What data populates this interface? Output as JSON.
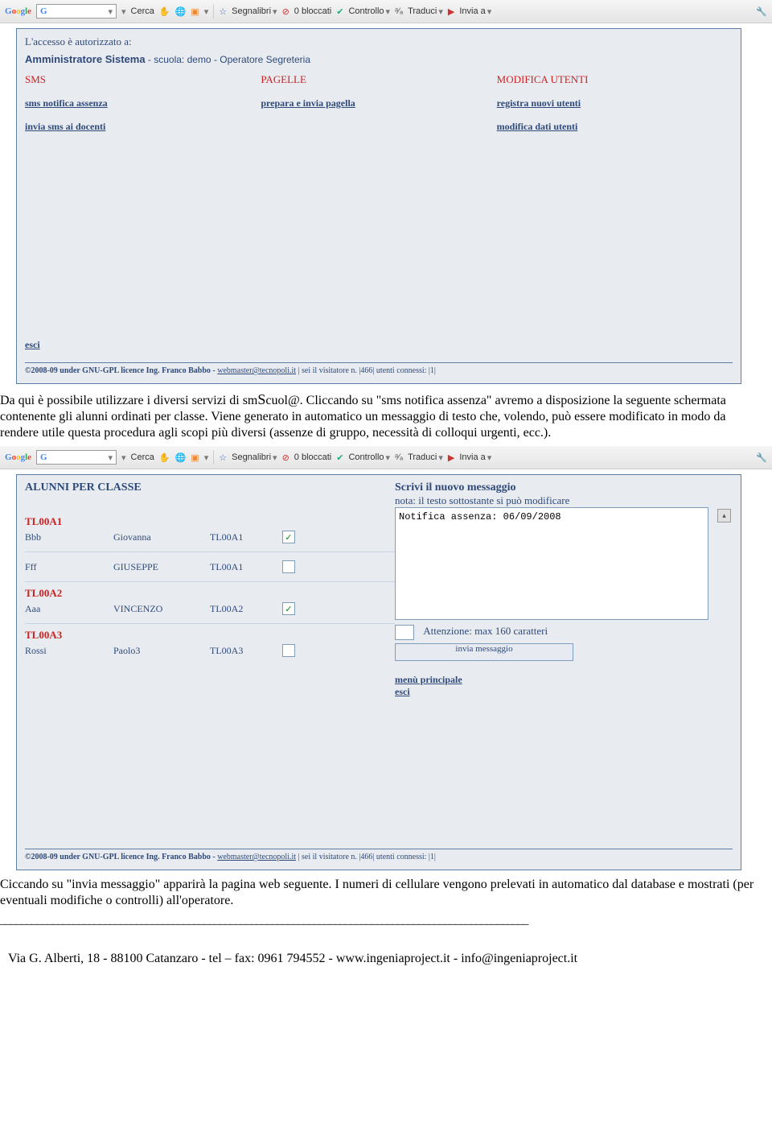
{
  "toolbar": {
    "logo_g": "G",
    "cerca": "Cerca",
    "segnalibri": "Segnalibri",
    "bloccati": "0 bloccati",
    "controllo": "Controllo",
    "traduci": "Traduci",
    "invia": "Invia a"
  },
  "screenshot1": {
    "access_line": "L'accesso è autorizzato a:",
    "admin_title": "Amministratore Sistema",
    "admin_sub": " - scuola: demo - Operatore Segreteria",
    "col1": {
      "head": "SMS",
      "link1": "sms notifica assenza",
      "link2": "invia sms ai docenti"
    },
    "col2": {
      "head": "PAGELLE",
      "link1": "prepara e invia pagella"
    },
    "col3": {
      "head": "MODIFICA UTENTI",
      "link1": "registra nuovi utenti",
      "link2": "modifica dati utenti"
    },
    "esci": "esci",
    "footer": {
      "copy": "©2008-09 under GNU-GPL licence Ing. Franco Babbo - ",
      "webmaster": "webmaster@tecnopoli.it",
      "visit": "  |  sei il visitatore n.  |466|  utenti connessi: |1|"
    }
  },
  "para1": "Da qui è possibile utilizzare i diversi servizi di smScuol@. Cliccando su \"sms notifica assenza\" avremo a disposizione la seguente schermata contenente gli alunni ordinati per classe. Viene generato in automatico un messaggio di testo che, volendo, può essere modificato in modo da rendere utile questa procedura agli scopi più diversi (assenze di gruppo, necessità di colloqui urgenti, ecc.).",
  "screenshot2": {
    "alunni_head": "ALUNNI PER CLASSE",
    "classes": [
      {
        "label": "TL00A1",
        "students": [
          {
            "surname": "Bbb",
            "name": "Giovanna",
            "class": "TL00A1",
            "checked": true
          },
          {
            "surname": "Fff",
            "name": "GIUSEPPE",
            "class": "TL00A1",
            "checked": false
          }
        ]
      },
      {
        "label": "TL00A2",
        "students": [
          {
            "surname": "Aaa",
            "name": "VINCENZO",
            "class": "TL00A2",
            "checked": true
          }
        ]
      },
      {
        "label": "TL00A3",
        "students": [
          {
            "surname": "Rossi",
            "name": "Paolo3",
            "class": "TL00A3",
            "checked": false
          }
        ]
      }
    ],
    "msg_title": "Scrivi il nuovo messaggio",
    "msg_sub": "nota: il testo sottostante si può modificare",
    "msg_text": "Notifica assenza: 06/09/2008",
    "att": "Attenzione: max 160 caratteri",
    "send": "invia messaggio",
    "menu_link": "menù principale",
    "esci": "esci",
    "footer": {
      "copy": "©2008-09 under GNU-GPL licence Ing. Franco Babbo - ",
      "webmaster": "webmaster@tecnopoli.it",
      "visit": "  |  sei il visitatore n.  |466|  utenti connessi: |1|"
    }
  },
  "para2": "Ciccando su \"invia messaggio\" apparirà la pagina web seguente. I numeri di cellulare vengono prelevati in automatico dal database e mostrati (per eventuali modifiche o controlli) all'operatore.",
  "dashes": "_____________________________________________________________________________________________________",
  "page_footer": "Via G. Alberti, 18 - 88100 Catanzaro  - tel – fax: 0961 794552 - www.ingeniaproject.it - info@ingeniaproject.it"
}
